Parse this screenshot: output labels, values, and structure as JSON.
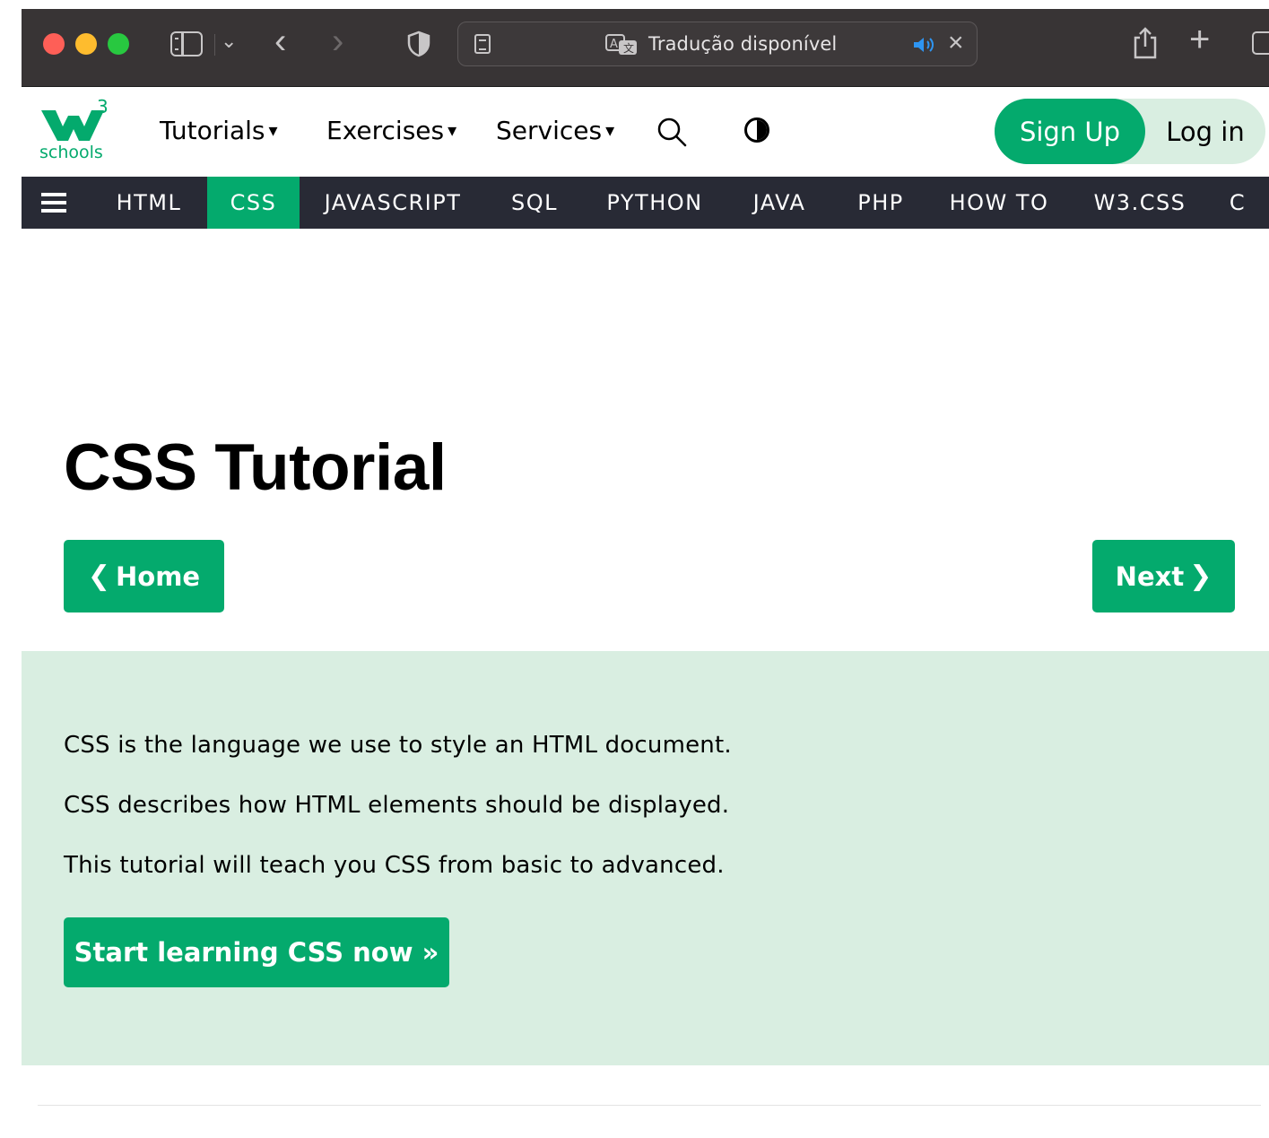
{
  "browser": {
    "address_text": "Tradução disponível",
    "icons": [
      "sidebar-icon",
      "chevron-down-icon",
      "back-arrow-icon",
      "forward-arrow-icon",
      "shield-icon",
      "reader-icon",
      "translate-icon",
      "speaker-icon",
      "close-icon",
      "share-icon",
      "plus-icon",
      "tabs-icon"
    ]
  },
  "topnav": {
    "logo_sup": "3",
    "logo_text": "schools",
    "links": [
      {
        "label": "Tutorials",
        "caret": "▾"
      },
      {
        "label": "Exercises",
        "caret": "▾"
      },
      {
        "label": "Services",
        "caret": "▾"
      }
    ],
    "signup_label": "Sign Up",
    "login_label": "Log in"
  },
  "subjects": {
    "items": [
      "HTML",
      "CSS",
      "JAVASCRIPT",
      "SQL",
      "PYTHON",
      "JAVA",
      "PHP",
      "HOW TO",
      "W3.CSS",
      "C"
    ],
    "active": "CSS"
  },
  "main": {
    "title": "CSS Tutorial",
    "home_label": "Home",
    "next_label": "Next",
    "intro": [
      "CSS is the language we use to style an HTML document.",
      "CSS describes how HTML elements should be displayed.",
      "This tutorial will teach you CSS from basic to advanced."
    ],
    "start_label": "Start learning CSS now »"
  },
  "colors": {
    "brand_green": "#04aa6d",
    "light_green": "#d9eee1",
    "subject_bar": "#282a35",
    "chrome": "#383435"
  }
}
